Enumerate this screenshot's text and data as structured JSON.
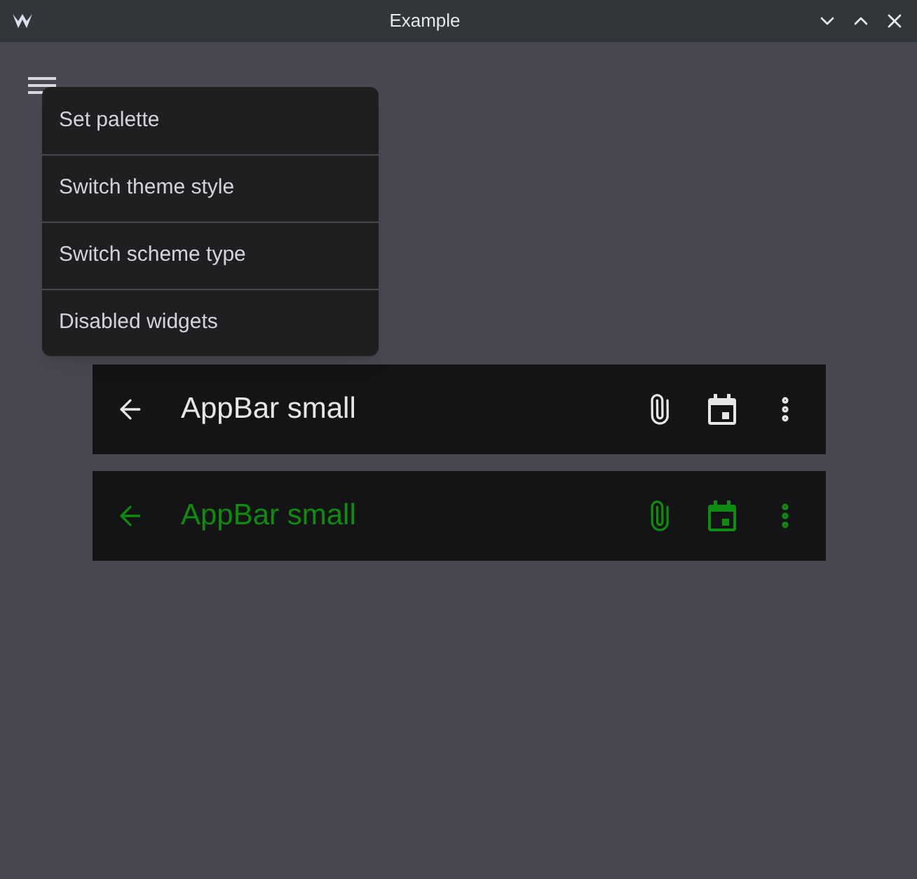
{
  "window": {
    "title": "Example"
  },
  "menu": {
    "items": [
      {
        "label": "Set palette"
      },
      {
        "label": "Switch theme style"
      },
      {
        "label": "Switch scheme type"
      },
      {
        "label": "Disabled widgets"
      }
    ]
  },
  "app_bars": [
    {
      "title": "AppBar small",
      "color": "#e6e6e6"
    },
    {
      "title": "AppBar small",
      "color": "#0f8c0f"
    }
  ]
}
